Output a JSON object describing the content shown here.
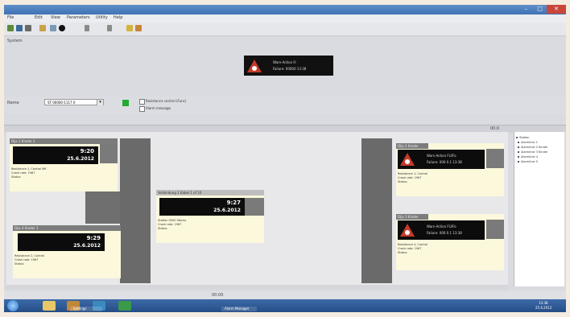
{
  "window": {
    "title": "",
    "minimize": "–",
    "maximize": "□",
    "close": "✕"
  },
  "menu": [
    "File",
    "Edit",
    "View",
    "Parameters",
    "Utility",
    "Help"
  ],
  "toolbar_icons": [
    "open-icon",
    "save-icon",
    "print-icon",
    "settings-icon",
    "record-icon",
    "back-icon",
    "forward-icon",
    "info-icon"
  ],
  "alarm_section_label": "System",
  "alarm_banner": {
    "line1": "Warn-Action Fr",
    "line2": "Failure: 00000 13:38"
  },
  "station_row": {
    "label": "Name",
    "combo_value": "ST 00000-1117 0",
    "checkbox1_label": "Resistance control (Func)",
    "checkbox2_label": "Alarm message"
  },
  "pane_header": {
    "right_label": "00:0"
  },
  "cards": [
    {
      "header": "Dlja 1 Kinder 1",
      "time": "9:20",
      "date": "25.6.2012",
      "info": [
        "Resistance 1, Control MK",
        "Crash rate: 1967",
        "Status:"
      ]
    },
    {
      "header": "Dlja 4 Kinder 1",
      "time": "9:29",
      "date": "25.6.2012",
      "info": [
        "Resistance 2, Control",
        "Crash rate: 1967",
        "Status:"
      ]
    },
    {
      "header": "Verbindung 1 Kabel 1 of 10",
      "time": "9:27",
      "date": "25.6.2012",
      "info": [
        "Station 0000 Stereo",
        "Crash rate: 1967",
        "Status:"
      ]
    },
    {
      "header": "Dlja 2 Kinder",
      "alert1": "Warn-Action FU/Fo",
      "alert2": "Failure: 000 0.1 13:38",
      "info": [
        "Resistance 1, Control",
        "Crash rate: 1967",
        "Status:"
      ]
    },
    {
      "header": "Dlja 3 Kinder",
      "alert1": "Warn-Action FU/Fo",
      "alert2": "Failure: 000 0.1 13:38",
      "info": [
        "Resistance 4, Control",
        "Crash rate: 1967",
        "Status:"
      ]
    }
  ],
  "tree": [
    "Station",
    "Alarmlinie 1",
    "Alarmlinie 2 Kinder",
    "Alarmlinie 3 Kinder",
    "Alarmlinie 4",
    "Alarmlinie 5"
  ],
  "status_bar": {
    "center": "00:00"
  },
  "taskbar": {
    "clock_time": "13:38",
    "clock_date": "25.6.2012",
    "buttons": [
      "Settings",
      "Alarm Manager"
    ]
  },
  "colors": {
    "titlebar": "#3f72b6",
    "alarm_red": "#c43a2a",
    "status_green": "#22aa33",
    "card_bg": "#fbf8dc"
  }
}
